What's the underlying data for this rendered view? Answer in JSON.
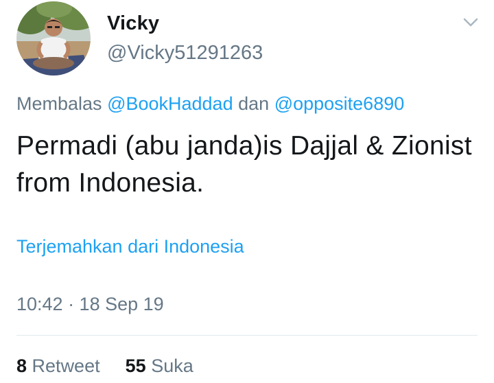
{
  "author": {
    "display_name": "Vicky",
    "handle": "@Vicky51291263",
    "avatar_icon": "user-avatar-photo"
  },
  "menu_icon": "chevron-down-icon",
  "reply": {
    "prefix": "Membalas",
    "mention_1": "@BookHaddad",
    "joiner": "dan",
    "mention_2": "@opposite6890"
  },
  "tweet_text": "Permadi (abu janda)is Dajjal & Zionist from Indonesia.",
  "translate_label": "Terjemahkan dari Indonesia",
  "timestamp": "10:42 · 18 Sep 19",
  "stats": {
    "retweet_count": "8",
    "retweet_label": "Retweet",
    "like_count": "55",
    "like_label": "Suka"
  },
  "colors": {
    "accent": "#1da1f2",
    "text_primary": "#14171a",
    "text_secondary": "#657786",
    "divider": "#e1e8ed"
  }
}
